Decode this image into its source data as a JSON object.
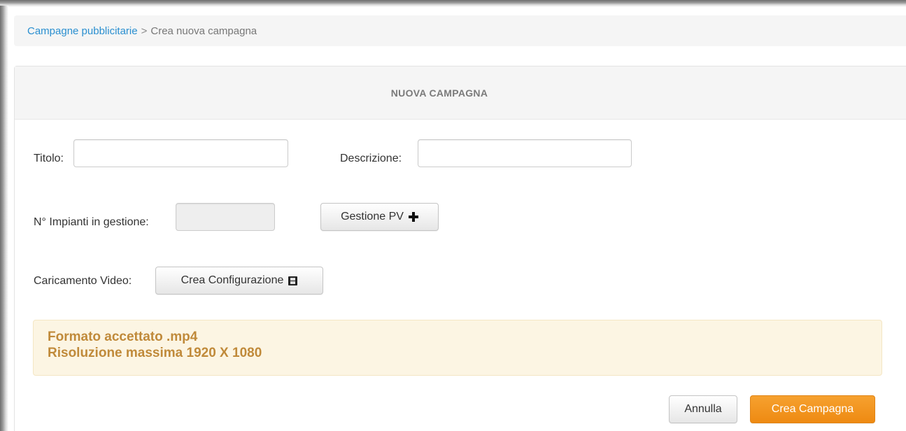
{
  "breadcrumb": {
    "parent": "Campagne pubblicitarie",
    "separator": ">",
    "current": "Crea nuova campagna"
  },
  "panel": {
    "title": "NUOVA CAMPAGNA"
  },
  "form": {
    "titolo_label": "Titolo:",
    "titolo_value": "",
    "descrizione_label": "Descrizione:",
    "descrizione_value": "",
    "impianti_label": "N° Impianti in gestione:",
    "impianti_value": "",
    "gestione_pv_label": "Gestione PV",
    "gestione_pv_icon": "plus-icon",
    "caricamento_label": "Caricamento Video:",
    "crea_config_label": "Crea Configurazione",
    "crea_config_icon": "film-icon"
  },
  "alert": {
    "line1": "Formato accettato .mp4",
    "line2": "Risoluzione massima 1920 X 1080"
  },
  "actions": {
    "cancel_label": "Annulla",
    "create_label": "Crea Campagna"
  },
  "colors": {
    "link": "#2a8fd0",
    "accent_orange": "#f0900f",
    "alert_bg": "#fcf5e3",
    "alert_text": "#c08a3a"
  }
}
